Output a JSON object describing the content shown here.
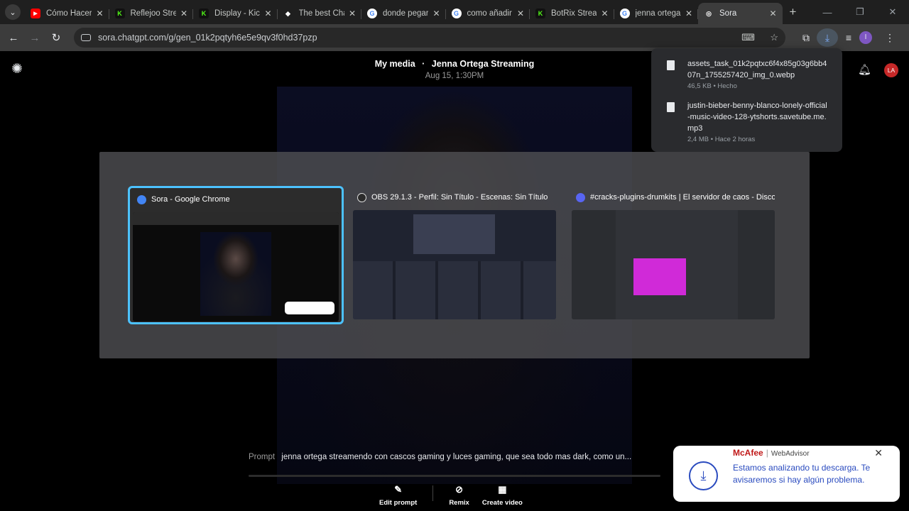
{
  "browser": {
    "tabs": [
      {
        "title": "Cómo Hacer",
        "fav_icon": "youtube-icon",
        "fav_color": "#ff0000",
        "fav_glyph": "▶"
      },
      {
        "title": "Reflejoo Stre",
        "fav_icon": "kick-icon",
        "fav_color": "#53fc18",
        "fav_glyph": "K"
      },
      {
        "title": "Display - Kick",
        "fav_icon": "kick-icon",
        "fav_color": "#53fc18",
        "fav_glyph": "K"
      },
      {
        "title": "The best Cha",
        "fav_icon": "diamond-icon",
        "fav_color": "#ffffff",
        "fav_glyph": "◆"
      },
      {
        "title": "donde pegar",
        "fav_icon": "google-icon",
        "fav_color": "#ffffff",
        "fav_glyph": "G"
      },
      {
        "title": "como añadir",
        "fav_icon": "google-icon",
        "fav_color": "#ffffff",
        "fav_glyph": "G"
      },
      {
        "title": "BotRix Stream",
        "fav_icon": "kick-icon",
        "fav_color": "#53fc18",
        "fav_glyph": "K"
      },
      {
        "title": "jenna ortega",
        "fav_icon": "google-icon",
        "fav_color": "#ffffff",
        "fav_glyph": "G"
      },
      {
        "title": "Sora",
        "fav_icon": "sora-icon",
        "fav_color": "#ffffff",
        "fav_glyph": "◎"
      }
    ],
    "active_tab": 8,
    "url": "sora.chatgpt.com/g/gen_01k2pqtyh6e5e9qv3f0hd37pzp",
    "profile_initial": "I"
  },
  "sora": {
    "breadcrumb": "My media",
    "title_sep": "·",
    "title": "Jenna Ortega Streaming",
    "date": "Aug 15, 1:30PM",
    "avatar_initials": "LA",
    "prompt_label": "Prompt",
    "prompt_text": "jenna ortega streamendo con cascos gaming y luces gaming, que sea todo mas dark, como un...",
    "actions": {
      "edit": "Edit prompt",
      "remix": "Remix",
      "create": "Create video"
    }
  },
  "downloads": [
    {
      "name": "assets_task_01k2pqtxc6f4x85g03g6bb407n_1755257420_img_0.webp",
      "meta": "46,5 KB • Hecho"
    },
    {
      "name": "justin-bieber-benny-blanco-lonely-official-music-video-128-ytshorts.savetube.me.mp3",
      "meta": "2,4 MB • Hace 2 horas"
    }
  ],
  "switcher": {
    "windows": [
      {
        "title": "Sora - Google Chrome",
        "app_icon": "chrome-icon",
        "icon_color": "#4285f4",
        "selected": true
      },
      {
        "title": "OBS 29.1.3 - Perfil: Sin Título - Escenas: Sin Título",
        "app_icon": "obs-icon",
        "icon_color": "#2b2b2b",
        "selected": false
      },
      {
        "title": "#cracks-plugins-drumkits | El servidor de caos - Disco...",
        "app_icon": "discord-icon",
        "icon_color": "#5865f2",
        "selected": false
      }
    ]
  },
  "mcafee": {
    "brand": "McAfee",
    "pipe": "|",
    "product": "WebAdvisor",
    "message": "Estamos analizando tu descarga. Te avisaremos si hay algún problema."
  }
}
